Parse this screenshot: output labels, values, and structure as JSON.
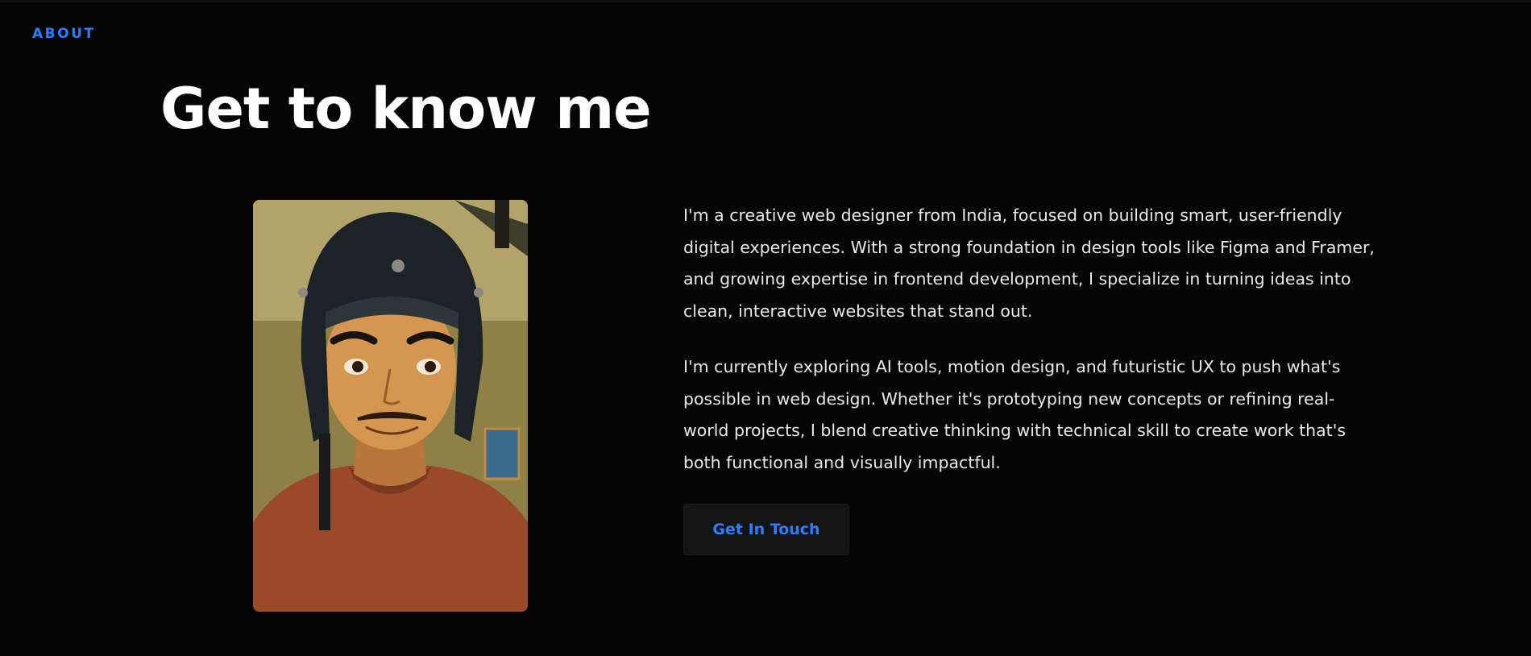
{
  "section": {
    "label": "ABOUT"
  },
  "heading": {
    "title": "Get to know me"
  },
  "portrait": {
    "description": "portrait-illustration"
  },
  "bio": {
    "paragraphs": [
      "I'm a creative web designer from India, focused on building smart, user-friendly digital experiences. With a strong foundation in design tools like Figma and Framer, and growing expertise in frontend development, I specialize in turning ideas into clean, interactive websites that stand out.",
      "I'm currently exploring AI tools, motion design, and futuristic UX to push what's possible in web design. Whether it's prototyping new concepts or refining real-world projects, I blend creative thinking with technical skill to create work that's both functional and visually impactful."
    ]
  },
  "cta": {
    "label": "Get In Touch"
  },
  "colors": {
    "background": "#050505",
    "accent": "#2a7fff",
    "text": "#ffffff",
    "body_text": "#e9e9e9",
    "button_bg": "#141414"
  }
}
